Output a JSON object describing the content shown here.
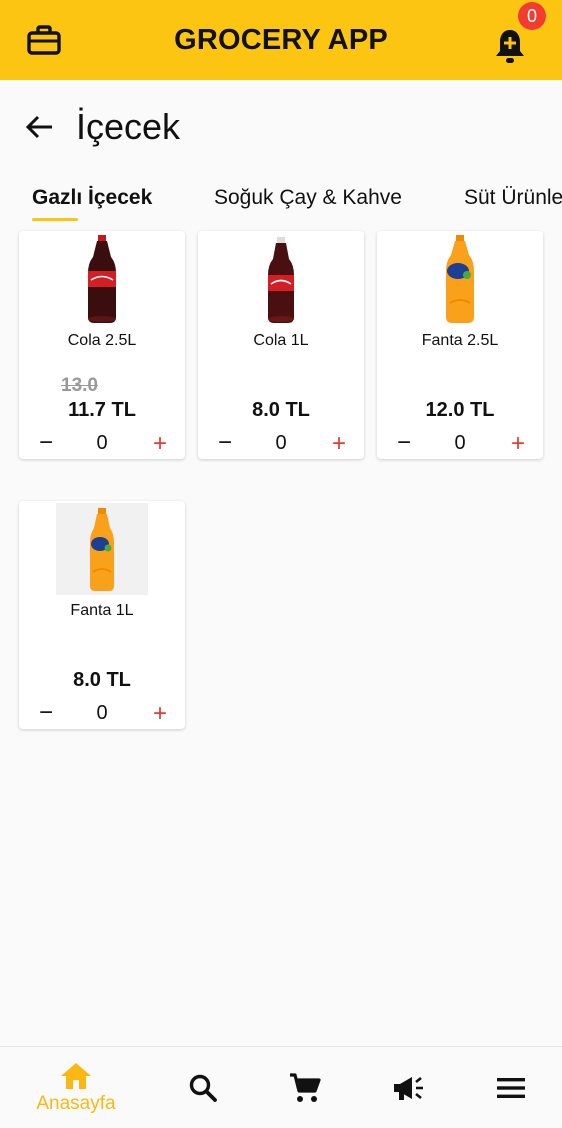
{
  "app_bar": {
    "title": "GROCERY APP",
    "notification_count": "0",
    "brand_color": "#fcc512",
    "icons": {
      "left": "briefcase-icon",
      "right": "bell-plus-icon"
    }
  },
  "page": {
    "title": "İçecek",
    "back_icon": "arrow-left-icon"
  },
  "tabs": [
    {
      "label": "Gazlı İçecek",
      "active": true
    },
    {
      "label": "Soğuk Çay & Kahve",
      "active": false
    },
    {
      "label": "Süt Ürünle",
      "active": false
    }
  ],
  "products": [
    {
      "name": "Cola 2.5L",
      "old_price": "13.0",
      "price": "11.7 TL",
      "quantity": "0",
      "image": "cola-bottle-large"
    },
    {
      "name": "Cola 1L",
      "old_price": "",
      "price": "8.0 TL",
      "quantity": "0",
      "image": "cola-bottle-small"
    },
    {
      "name": "Fanta 2.5L",
      "old_price": "",
      "price": "12.0 TL",
      "quantity": "0",
      "image": "fanta-bottle-large"
    },
    {
      "name": "Fanta 1L",
      "old_price": "",
      "price": "8.0 TL",
      "quantity": "0",
      "image": "fanta-bottle-small"
    }
  ],
  "stepper": {
    "minus": "−",
    "plus": "+"
  },
  "bottom_nav": [
    {
      "label": "Anasayfa",
      "icon": "home-icon",
      "active": true
    },
    {
      "label": "",
      "icon": "search-icon",
      "active": false
    },
    {
      "label": "",
      "icon": "cart-icon",
      "active": false
    },
    {
      "label": "",
      "icon": "megaphone-icon",
      "active": false
    },
    {
      "label": "",
      "icon": "menu-icon",
      "active": false
    }
  ],
  "colors": {
    "accent": "#fcc512",
    "active_nav": "#fcb812",
    "plus": "#e23b2f",
    "badge": "#f23b31"
  }
}
